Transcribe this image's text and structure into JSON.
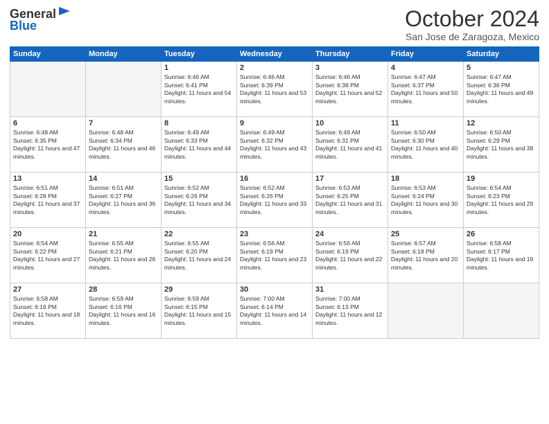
{
  "header": {
    "logo_line1": "General",
    "logo_line2": "Blue",
    "month": "October 2024",
    "location": "San Jose de Zaragoza, Mexico"
  },
  "weekdays": [
    "Sunday",
    "Monday",
    "Tuesday",
    "Wednesday",
    "Thursday",
    "Friday",
    "Saturday"
  ],
  "weeks": [
    [
      {
        "day": "",
        "sunrise": "",
        "sunset": "",
        "daylight": ""
      },
      {
        "day": "",
        "sunrise": "",
        "sunset": "",
        "daylight": ""
      },
      {
        "day": "1",
        "sunrise": "Sunrise: 6:46 AM",
        "sunset": "Sunset: 6:41 PM",
        "daylight": "Daylight: 11 hours and 54 minutes."
      },
      {
        "day": "2",
        "sunrise": "Sunrise: 6:46 AM",
        "sunset": "Sunset: 6:39 PM",
        "daylight": "Daylight: 11 hours and 53 minutes."
      },
      {
        "day": "3",
        "sunrise": "Sunrise: 6:46 AM",
        "sunset": "Sunset: 6:38 PM",
        "daylight": "Daylight: 11 hours and 52 minutes."
      },
      {
        "day": "4",
        "sunrise": "Sunrise: 6:47 AM",
        "sunset": "Sunset: 6:37 PM",
        "daylight": "Daylight: 11 hours and 50 minutes."
      },
      {
        "day": "5",
        "sunrise": "Sunrise: 6:47 AM",
        "sunset": "Sunset: 6:36 PM",
        "daylight": "Daylight: 11 hours and 49 minutes."
      }
    ],
    [
      {
        "day": "6",
        "sunrise": "Sunrise: 6:48 AM",
        "sunset": "Sunset: 6:35 PM",
        "daylight": "Daylight: 11 hours and 47 minutes."
      },
      {
        "day": "7",
        "sunrise": "Sunrise: 6:48 AM",
        "sunset": "Sunset: 6:34 PM",
        "daylight": "Daylight: 11 hours and 46 minutes."
      },
      {
        "day": "8",
        "sunrise": "Sunrise: 6:49 AM",
        "sunset": "Sunset: 6:33 PM",
        "daylight": "Daylight: 11 hours and 44 minutes."
      },
      {
        "day": "9",
        "sunrise": "Sunrise: 6:49 AM",
        "sunset": "Sunset: 6:32 PM",
        "daylight": "Daylight: 11 hours and 43 minutes."
      },
      {
        "day": "10",
        "sunrise": "Sunrise: 6:49 AM",
        "sunset": "Sunset: 6:31 PM",
        "daylight": "Daylight: 11 hours and 41 minutes."
      },
      {
        "day": "11",
        "sunrise": "Sunrise: 6:50 AM",
        "sunset": "Sunset: 6:30 PM",
        "daylight": "Daylight: 11 hours and 40 minutes."
      },
      {
        "day": "12",
        "sunrise": "Sunrise: 6:50 AM",
        "sunset": "Sunset: 6:29 PM",
        "daylight": "Daylight: 11 hours and 38 minutes."
      }
    ],
    [
      {
        "day": "13",
        "sunrise": "Sunrise: 6:51 AM",
        "sunset": "Sunset: 6:28 PM",
        "daylight": "Daylight: 11 hours and 37 minutes."
      },
      {
        "day": "14",
        "sunrise": "Sunrise: 6:51 AM",
        "sunset": "Sunset: 6:27 PM",
        "daylight": "Daylight: 11 hours and 36 minutes."
      },
      {
        "day": "15",
        "sunrise": "Sunrise: 6:52 AM",
        "sunset": "Sunset: 6:26 PM",
        "daylight": "Daylight: 11 hours and 34 minutes."
      },
      {
        "day": "16",
        "sunrise": "Sunrise: 6:52 AM",
        "sunset": "Sunset: 6:26 PM",
        "daylight": "Daylight: 11 hours and 33 minutes."
      },
      {
        "day": "17",
        "sunrise": "Sunrise: 6:53 AM",
        "sunset": "Sunset: 6:25 PM",
        "daylight": "Daylight: 11 hours and 31 minutes."
      },
      {
        "day": "18",
        "sunrise": "Sunrise: 6:53 AM",
        "sunset": "Sunset: 6:24 PM",
        "daylight": "Daylight: 11 hours and 30 minutes."
      },
      {
        "day": "19",
        "sunrise": "Sunrise: 6:54 AM",
        "sunset": "Sunset: 6:23 PM",
        "daylight": "Daylight: 11 hours and 29 minutes."
      }
    ],
    [
      {
        "day": "20",
        "sunrise": "Sunrise: 6:54 AM",
        "sunset": "Sunset: 6:22 PM",
        "daylight": "Daylight: 11 hours and 27 minutes."
      },
      {
        "day": "21",
        "sunrise": "Sunrise: 6:55 AM",
        "sunset": "Sunset: 6:21 PM",
        "daylight": "Daylight: 11 hours and 26 minutes."
      },
      {
        "day": "22",
        "sunrise": "Sunrise: 6:55 AM",
        "sunset": "Sunset: 6:20 PM",
        "daylight": "Daylight: 11 hours and 24 minutes."
      },
      {
        "day": "23",
        "sunrise": "Sunrise: 6:56 AM",
        "sunset": "Sunset: 6:19 PM",
        "daylight": "Daylight: 11 hours and 23 minutes."
      },
      {
        "day": "24",
        "sunrise": "Sunrise: 6:56 AM",
        "sunset": "Sunset: 6:19 PM",
        "daylight": "Daylight: 11 hours and 22 minutes."
      },
      {
        "day": "25",
        "sunrise": "Sunrise: 6:57 AM",
        "sunset": "Sunset: 6:18 PM",
        "daylight": "Daylight: 11 hours and 20 minutes."
      },
      {
        "day": "26",
        "sunrise": "Sunrise: 6:58 AM",
        "sunset": "Sunset: 6:17 PM",
        "daylight": "Daylight: 11 hours and 19 minutes."
      }
    ],
    [
      {
        "day": "27",
        "sunrise": "Sunrise: 6:58 AM",
        "sunset": "Sunset: 6:16 PM",
        "daylight": "Daylight: 11 hours and 18 minutes."
      },
      {
        "day": "28",
        "sunrise": "Sunrise: 6:59 AM",
        "sunset": "Sunset: 6:16 PM",
        "daylight": "Daylight: 11 hours and 16 minutes."
      },
      {
        "day": "29",
        "sunrise": "Sunrise: 6:59 AM",
        "sunset": "Sunset: 6:15 PM",
        "daylight": "Daylight: 11 hours and 15 minutes."
      },
      {
        "day": "30",
        "sunrise": "Sunrise: 7:00 AM",
        "sunset": "Sunset: 6:14 PM",
        "daylight": "Daylight: 11 hours and 14 minutes."
      },
      {
        "day": "31",
        "sunrise": "Sunrise: 7:00 AM",
        "sunset": "Sunset: 6:13 PM",
        "daylight": "Daylight: 11 hours and 12 minutes."
      },
      {
        "day": "",
        "sunrise": "",
        "sunset": "",
        "daylight": ""
      },
      {
        "day": "",
        "sunrise": "",
        "sunset": "",
        "daylight": ""
      }
    ]
  ]
}
